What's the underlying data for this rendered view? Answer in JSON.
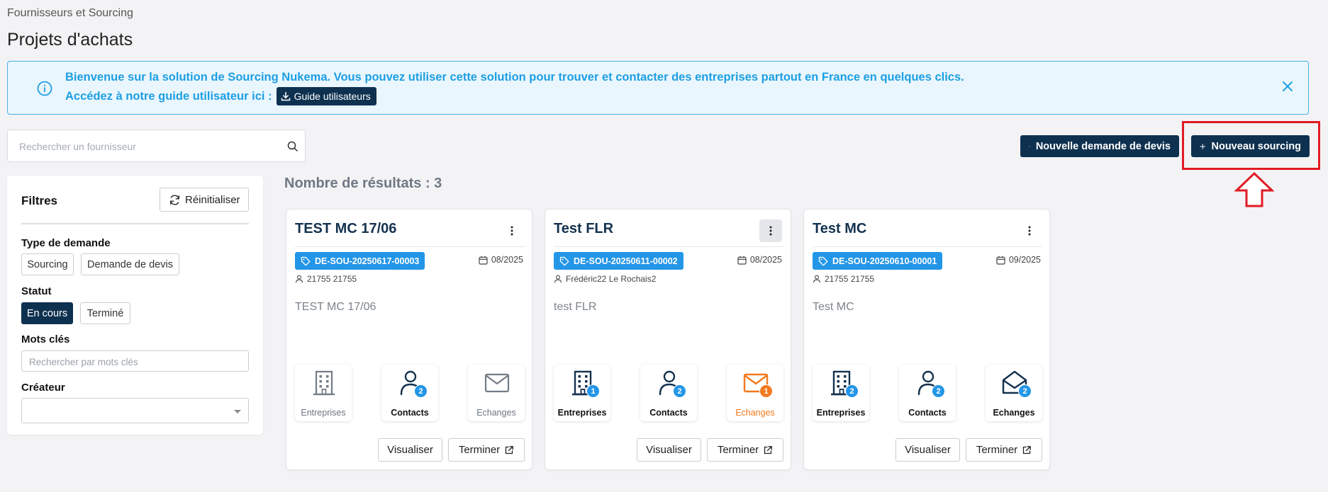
{
  "breadcrumb": "Fournisseurs et Sourcing",
  "page_title": "Projets d'achats",
  "banner": {
    "line1": "Bienvenue sur la solution de Sourcing Nukema. Vous pouvez utiliser cette solution pour trouver et contacter des entreprises partout en France en quelques clics.",
    "line2": "Accédez à notre guide utilisateur ici :",
    "guide_button": "Guide utilisateurs",
    "accent_color": "#1d9fe3"
  },
  "search": {
    "placeholder": "Rechercher un fournisseur"
  },
  "actions": {
    "new_quote": "Nouvelle demande de devis",
    "new_sourcing": "Nouveau sourcing",
    "primary_color": "#0f3150",
    "highlight_color": "#e01b24"
  },
  "filters": {
    "title": "Filtres",
    "reset": "Réinitialiser",
    "type_label": "Type de demande",
    "type_options": [
      "Sourcing",
      "Demande de devis"
    ],
    "status_label": "Statut",
    "status_options": [
      "En cours",
      "Terminé"
    ],
    "status_selected": "En cours",
    "keywords_label": "Mots clés",
    "keywords_placeholder": "Rechercher par mots clés",
    "creator_label": "Créateur",
    "creator_value": ""
  },
  "results_label": "Nombre de résultats : 3",
  "cards": [
    {
      "title": "TEST MC 17/06",
      "ref": "DE-SOU-20250617-00003",
      "date": "08/2025",
      "owner": "21755 21755",
      "description": "TEST MC 17/06",
      "tiles": [
        {
          "label": "Entreprises",
          "count": "",
          "icon": "building-icon"
        },
        {
          "label": "Contacts",
          "count": "2",
          "icon": "user-icon"
        },
        {
          "label": "Echanges",
          "count": "",
          "icon": "mail-icon"
        }
      ],
      "view": "Visualiser",
      "finish": "Terminer"
    },
    {
      "title": "Test FLR",
      "ref": "DE-SOU-20250611-00002",
      "date": "08/2025",
      "owner": "Frédéric22 Le Rochais2",
      "description": "test FLR",
      "tiles": [
        {
          "label": "Entreprises",
          "count": "1",
          "icon": "building-icon"
        },
        {
          "label": "Contacts",
          "count": "2",
          "icon": "user-icon"
        },
        {
          "label": "Echanges",
          "count": "1",
          "icon": "mail-icon"
        }
      ],
      "view": "Visualiser",
      "finish": "Terminer"
    },
    {
      "title": "Test MC",
      "ref": "DE-SOU-20250610-00001",
      "date": "09/2025",
      "owner": "21755 21755",
      "description": "Test MC",
      "tiles": [
        {
          "label": "Entreprises",
          "count": "2",
          "icon": "building-icon"
        },
        {
          "label": "Contacts",
          "count": "2",
          "icon": "user-icon"
        },
        {
          "label": "Echanges",
          "count": "2",
          "icon": "mail-open-icon"
        }
      ],
      "view": "Visualiser",
      "finish": "Terminer"
    }
  ]
}
